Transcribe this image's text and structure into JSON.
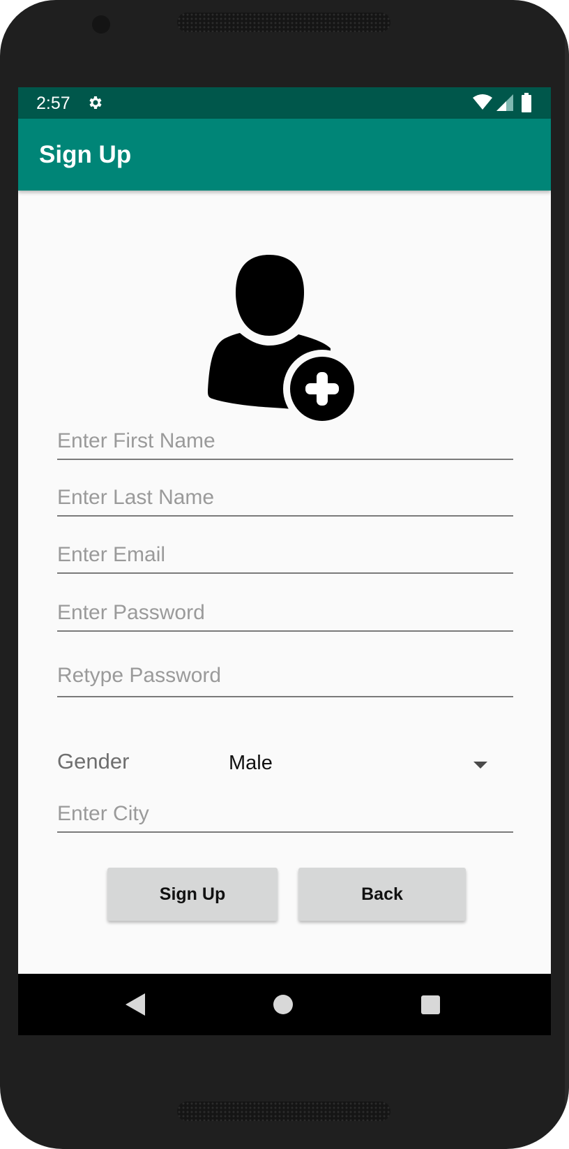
{
  "status_bar": {
    "time": "2:57",
    "icons": [
      "gear-icon",
      "wifi-icon",
      "cell-signal-icon",
      "battery-icon"
    ]
  },
  "app_bar": {
    "title": "Sign Up",
    "color": "#008577",
    "status_color": "#00574b"
  },
  "avatar": {
    "icon": "add-user-icon"
  },
  "form": {
    "first_name": {
      "placeholder": "Enter First Name",
      "value": ""
    },
    "last_name": {
      "placeholder": "Enter Last Name",
      "value": ""
    },
    "email": {
      "placeholder": "Enter Email",
      "value": ""
    },
    "password": {
      "placeholder": "Enter Password",
      "value": ""
    },
    "retype_password": {
      "placeholder": "Retype Password",
      "value": ""
    },
    "gender": {
      "label": "Gender",
      "selected": "Male"
    },
    "city": {
      "placeholder": "Enter City",
      "value": ""
    }
  },
  "buttons": {
    "sign_up": "Sign Up",
    "back": "Back"
  },
  "nav_bar": {
    "icons": [
      "back-icon",
      "home-icon",
      "recents-icon"
    ]
  }
}
